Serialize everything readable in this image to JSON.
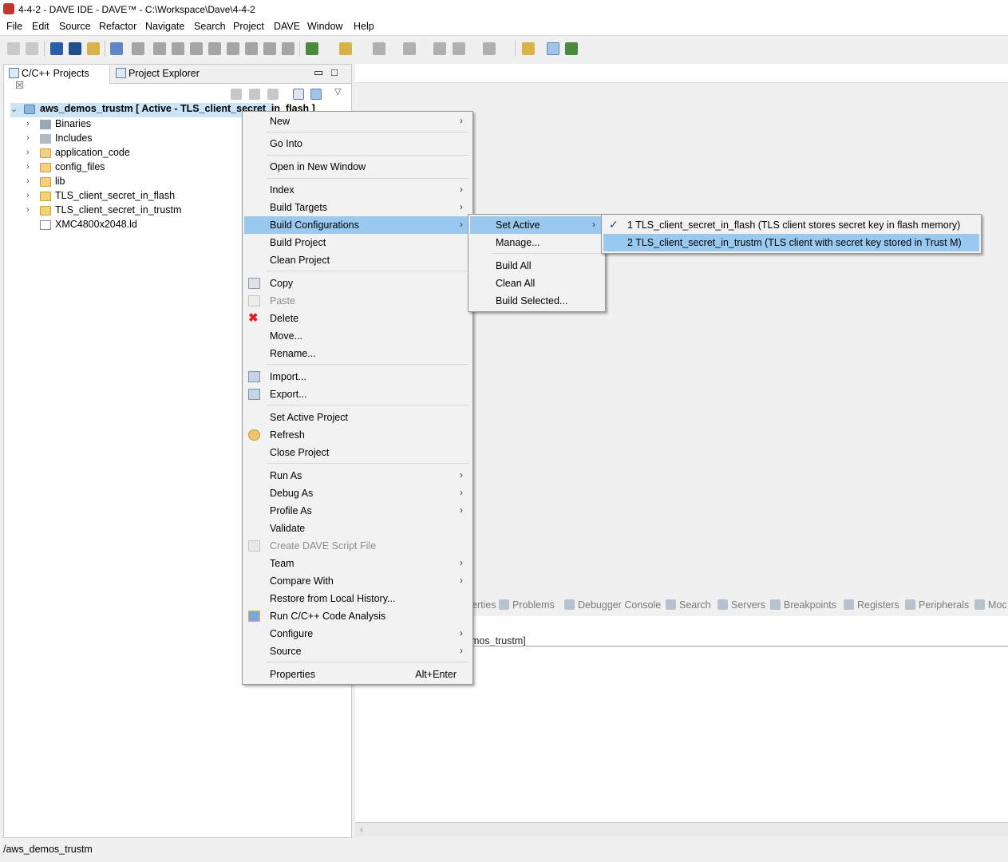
{
  "window": {
    "title": "4-4-2 - DAVE IDE - DAVE™ - C:\\Workspace\\Dave\\4-4-2"
  },
  "menubar": [
    "File",
    "Edit",
    "Source",
    "Refactor",
    "Navigate",
    "Search",
    "Project",
    "DAVE",
    "Window",
    "Help"
  ],
  "left_panel": {
    "tabs": [
      {
        "label": "C/C++ Projects",
        "close": "☒"
      },
      {
        "label": "Project Explorer"
      }
    ],
    "project": "aws_demos_trustm [ Active - TLS_client_secret_in_flash ]",
    "tree": [
      {
        "label": "Binaries",
        "icon": "binaries-icon"
      },
      {
        "label": "Includes",
        "icon": "includes-icon"
      },
      {
        "label": "application_code",
        "icon": "folder-icon"
      },
      {
        "label": "config_files",
        "icon": "folder-icon"
      },
      {
        "label": "lib",
        "icon": "folder-icon"
      },
      {
        "label": "TLS_client_secret_in_flash",
        "icon": "folder-icon"
      },
      {
        "label": "TLS_client_secret_in_trustm",
        "icon": "folder-icon"
      },
      {
        "label": "XMC4800x2048.ld",
        "icon": "file-icon"
      }
    ]
  },
  "context_menu": {
    "items": [
      {
        "label": "New",
        "submenu": true
      },
      {
        "label": "Go Into"
      },
      {
        "label": "Open in New Window"
      },
      {
        "label": "Index",
        "submenu": true
      },
      {
        "label": "Build Targets",
        "submenu": true
      },
      {
        "label": "Build Configurations",
        "submenu": true,
        "highlighted": true
      },
      {
        "label": "Build Project"
      },
      {
        "label": "Clean Project"
      },
      {
        "label": "Copy",
        "icon": "copy-icon"
      },
      {
        "label": "Paste",
        "icon": "paste-icon",
        "disabled": true
      },
      {
        "label": "Delete",
        "icon": "delete-icon"
      },
      {
        "label": "Move..."
      },
      {
        "label": "Rename..."
      },
      {
        "label": "Import...",
        "icon": "import-icon"
      },
      {
        "label": "Export...",
        "icon": "export-icon"
      },
      {
        "label": "Set Active Project"
      },
      {
        "label": "Refresh",
        "icon": "refresh-icon"
      },
      {
        "label": "Close Project"
      },
      {
        "label": "Run As",
        "submenu": true
      },
      {
        "label": "Debug As",
        "submenu": true
      },
      {
        "label": "Profile As",
        "submenu": true
      },
      {
        "label": "Validate"
      },
      {
        "label": "Create DAVE Script File",
        "disabled": true
      },
      {
        "label": "Team",
        "submenu": true
      },
      {
        "label": "Compare With",
        "submenu": true
      },
      {
        "label": "Restore from Local History..."
      },
      {
        "label": "Run C/C++ Code Analysis",
        "icon": "code-analysis-icon"
      },
      {
        "label": "Configure",
        "submenu": true
      },
      {
        "label": "Source",
        "submenu": true
      },
      {
        "label": "Properties",
        "accelerator": "Alt+Enter"
      }
    ]
  },
  "build_config_menu": {
    "items": [
      {
        "label": "Set Active",
        "submenu": true,
        "highlighted": true
      },
      {
        "label": "Manage..."
      },
      {
        "label": "Build All"
      },
      {
        "label": "Clean All"
      },
      {
        "label": "Build Selected..."
      }
    ]
  },
  "set_active_menu": {
    "items": [
      {
        "label": "1 TLS_client_secret_in_flash (TLS client stores secret key in flash memory)",
        "checked": true
      },
      {
        "label": "2 TLS_client_secret_in_trustm (TLS client with secret key stored in Trust M)",
        "highlighted": true
      }
    ]
  },
  "bottom_panel": {
    "tabs": [
      "erties",
      "Problems",
      "Debugger Console",
      "Search",
      "Servers",
      "Breakpoints",
      "Registers",
      "Peripherals",
      "Moc"
    ],
    "console_text": "mos_trustm]"
  },
  "statusbar": {
    "text": "/aws_demos_trustm"
  },
  "colors": {
    "highlight": "#99c9ef",
    "menu_bg": "#f2f2f2",
    "delete_red": "#d9202b"
  }
}
